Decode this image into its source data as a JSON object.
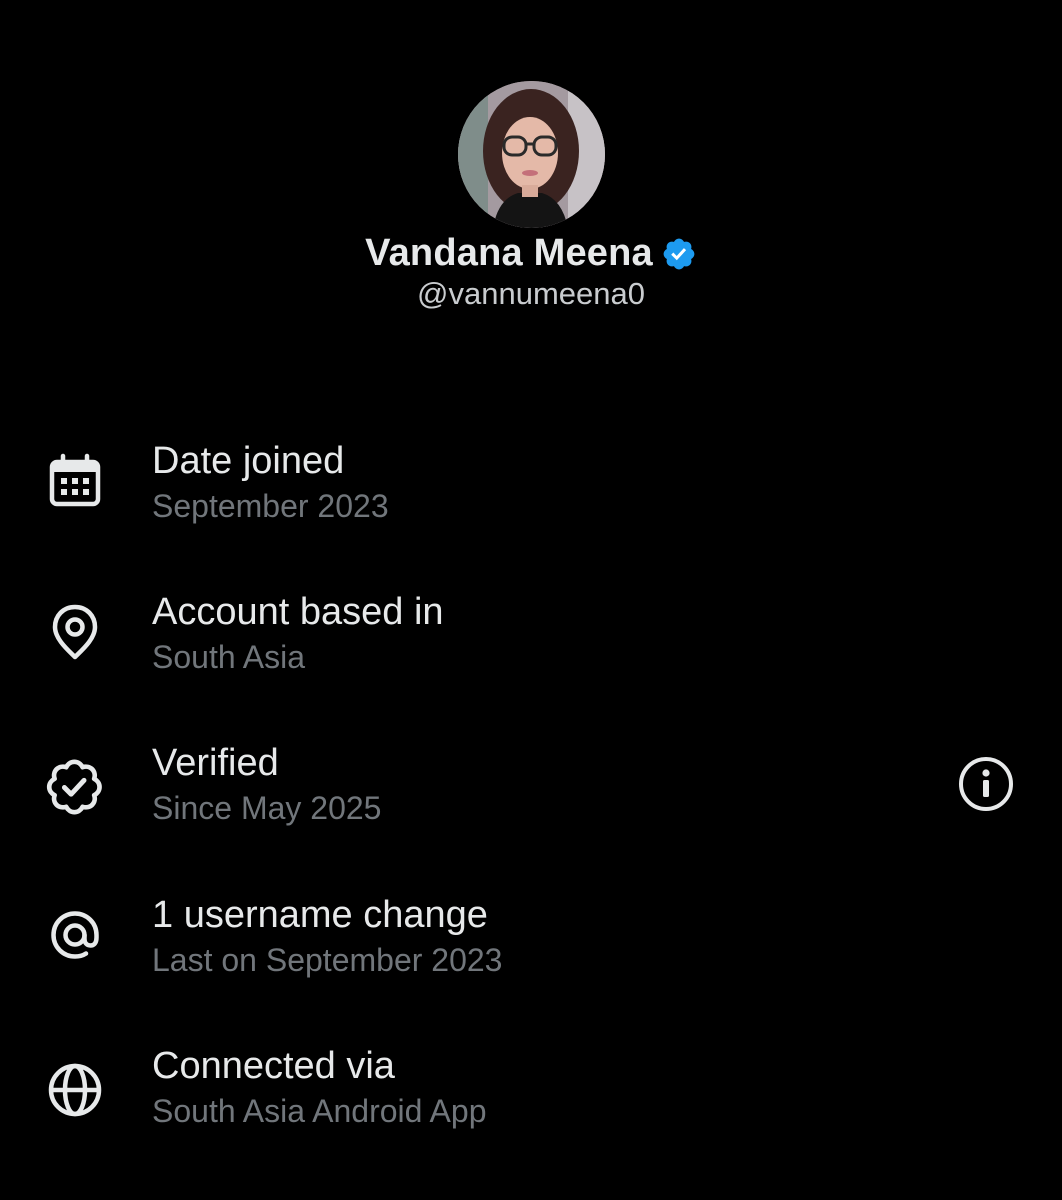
{
  "profile": {
    "display_name": "Vandana Meena",
    "handle": "@vannumeena0",
    "verified_badge_color": "#1d9bf0"
  },
  "about": {
    "items": [
      {
        "icon": "calendar-icon",
        "title": "Date joined",
        "subtitle": "September 2023"
      },
      {
        "icon": "location-pin-icon",
        "title": "Account based in",
        "subtitle": "South Asia"
      },
      {
        "icon": "verified-badge-outline-icon",
        "title": "Verified",
        "subtitle": "Since May 2025",
        "has_info": true
      },
      {
        "icon": "at-sign-icon",
        "title": "1 username change",
        "subtitle": "Last on September 2023"
      },
      {
        "icon": "globe-icon",
        "title": "Connected via",
        "subtitle": "South Asia Android App"
      }
    ]
  },
  "colors": {
    "background": "#000000",
    "primary_text": "#e7e9ea",
    "secondary_text": "#71767b",
    "icon": "#e7e9ea"
  }
}
